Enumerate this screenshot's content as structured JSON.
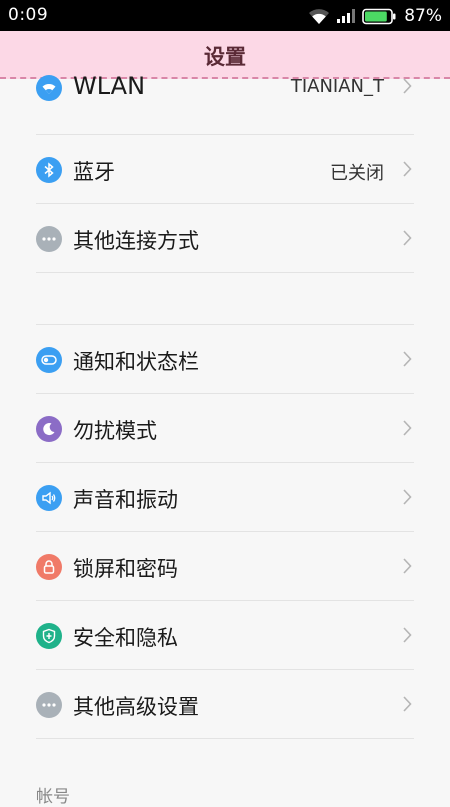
{
  "status": {
    "time": "0:09",
    "battery": "87%",
    "battery_level": 0.87
  },
  "header": {
    "title": "设置"
  },
  "items": [
    {
      "label": "WLAN",
      "value": "TIANIAN_T",
      "icon": "wifi-icon",
      "color": "#3b9ff2"
    },
    {
      "label": "蓝牙",
      "value": "已关闭",
      "icon": "bluetooth-icon",
      "color": "#3b9ff2"
    },
    {
      "label": "其他连接方式",
      "value": "",
      "icon": "more-icon",
      "color": "#a9b1b8"
    },
    {
      "label": "通知和状态栏",
      "value": "",
      "icon": "toggle-icon",
      "color": "#3b9ff2"
    },
    {
      "label": "勿扰模式",
      "value": "",
      "icon": "moon-icon",
      "color": "#8b6cc6"
    },
    {
      "label": "声音和振动",
      "value": "",
      "icon": "speaker-icon",
      "color": "#3b9ff2"
    },
    {
      "label": "锁屏和密码",
      "value": "",
      "icon": "lock-icon",
      "color": "#f07a68"
    },
    {
      "label": "安全和隐私",
      "value": "",
      "icon": "shield-icon",
      "color": "#1fb28a"
    },
    {
      "label": "其他高级设置",
      "value": "",
      "icon": "more-icon",
      "color": "#a9b1b8"
    }
  ],
  "section": {
    "account_label": "帐号"
  }
}
